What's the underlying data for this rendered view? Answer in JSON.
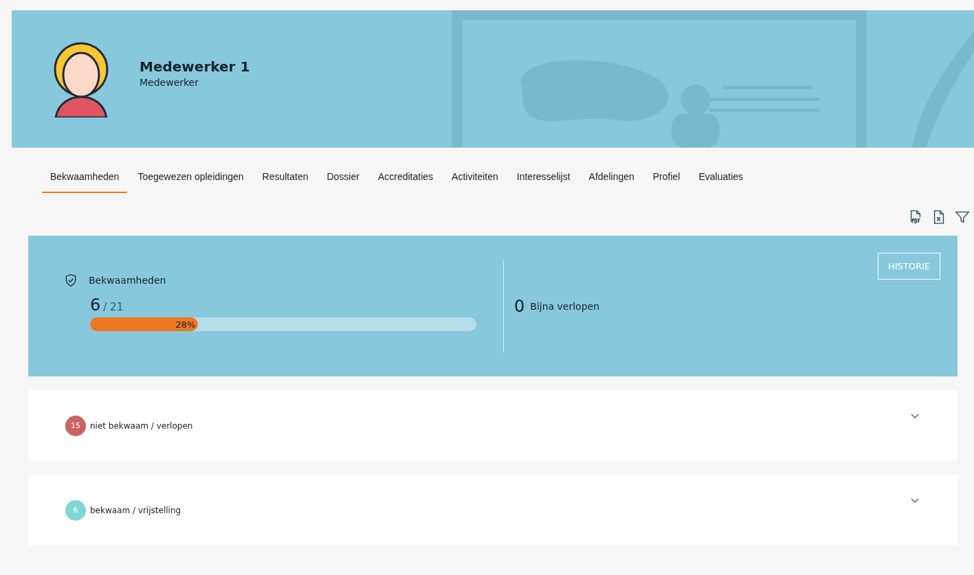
{
  "profile": {
    "name": "Medewerker 1",
    "role": "Medewerker"
  },
  "tabs": [
    {
      "label": "Bekwaamheden",
      "selected": true
    },
    {
      "label": "Toegewezen opleidingen",
      "selected": false
    },
    {
      "label": "Resultaten",
      "selected": false
    },
    {
      "label": "Dossier",
      "selected": false
    },
    {
      "label": "Accreditaties",
      "selected": false
    },
    {
      "label": "Activiteiten",
      "selected": false
    },
    {
      "label": "Interesselijst",
      "selected": false
    },
    {
      "label": "Afdelingen",
      "selected": false
    },
    {
      "label": "Profiel",
      "selected": false
    },
    {
      "label": "Evaluaties",
      "selected": false
    }
  ],
  "summary": {
    "title": "Bekwaamheden",
    "count": "6",
    "total": "/ 21",
    "level": 0.28,
    "percent": "28%",
    "expiring_count": "0",
    "expiring_label": "Bijna verlopen",
    "history_button": "HISTORIE"
  },
  "groups": [
    {
      "count": "15",
      "label": "niet bekwaam / verlopen",
      "color": "#cd6262",
      "expanded": false
    },
    {
      "count": "6",
      "label": "bekwaam / vrijstelling",
      "color": "#7fd7d5",
      "expanded": false
    }
  ]
}
